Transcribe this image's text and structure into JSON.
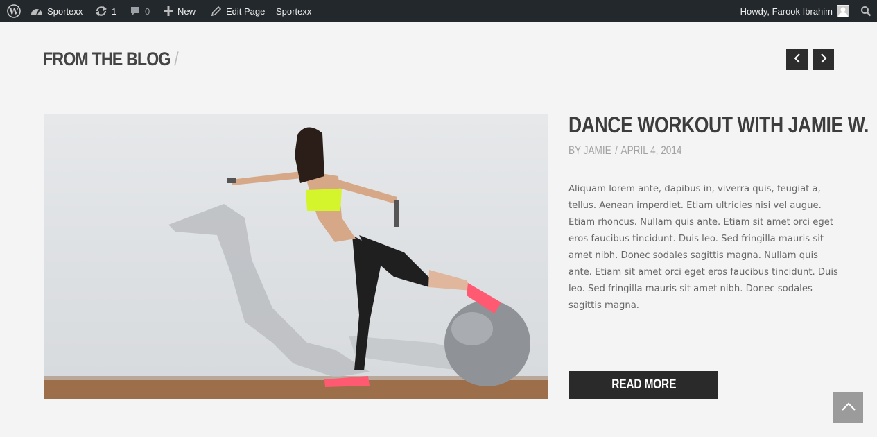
{
  "adminbar": {
    "site_name": "Sportexx",
    "updates_count": "1",
    "comments_count": "0",
    "new_label": "New",
    "edit_label": "Edit Page",
    "theme_label": "Sportexx",
    "greeting": "Howdy, Farook Ibrahim",
    "icons": [
      "wordpress-icon",
      "dashboard-icon",
      "refresh-icon",
      "comment-icon",
      "plus-icon",
      "pencil-icon",
      "avatar",
      "search-icon"
    ],
    "background": "#23282d"
  },
  "section": {
    "title": "FROM THE BLOG",
    "slash": "/",
    "prev_icon": "chevron-left-icon",
    "next_icon": "chevron-right-icon"
  },
  "post": {
    "title": "DANCE WORKOUT WITH JAMIE W.",
    "meta_author": "BY JAMIE",
    "meta_sep": "/",
    "meta_date": "APRIL 4, 2014",
    "excerpt": "Aliquam lorem ante, dapibus in, viverra quis, feugiat a, tellus. Aenean imperdiet. Etiam ultricies nisi vel augue. Etiam rhoncus. Nullam quis ante. Etiam sit amet orci eget eros faucibus tincidunt. Duis leo. Sed fringilla mauris sit amet nibh. Donec sodales sagittis magna. Nullam quis ante. Etiam sit amet orci eget eros faucibus tincidunt. Duis leo. Sed fringilla mauris sit amet nibh. Donec sodales sagittis magna.",
    "read_more": "READ MORE"
  },
  "colors": {
    "page_bg": "#f4f4f4",
    "dark_button": "#2a2a2a",
    "title_text": "#3d3d3d",
    "meta_text": "#a2a2a2",
    "shoe_accent": "#ff5a72",
    "top_accent": "#d4f52b",
    "scroll_top_bg": "#9b9b9b"
  }
}
